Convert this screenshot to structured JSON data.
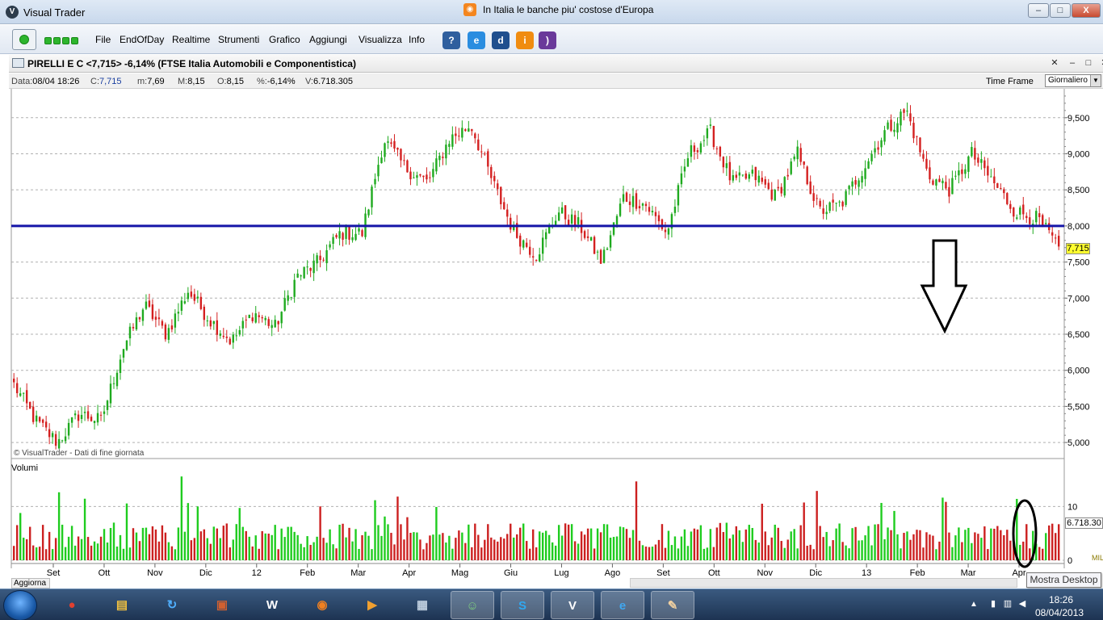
{
  "window": {
    "app_title": "Visual Trader",
    "news_headline": "In Italia le banche piu' costose d'Europa",
    "min_label": "–",
    "max_label": "□",
    "close_label": "X"
  },
  "menu": {
    "items": [
      "File",
      "EndOfDay",
      "Realtime",
      "Strumenti",
      "Grafico",
      "Aggiungi",
      "Visualizza",
      "Info"
    ]
  },
  "chart_window": {
    "title": "PIRELLI E C <7,715> -6,14%  (FTSE Italia Automobili e Componentistica)",
    "info": {
      "data_label": "Data:",
      "data_value": "08/04 18:26",
      "c_label": "C:",
      "c_value": "7,715",
      "m_label": "m:",
      "m_value": "7,69",
      "M_label": "M:",
      "M_value": "8,15",
      "o_label": "O:",
      "o_value": "8,15",
      "pct_label": "%:",
      "pct_value": "-6,14%",
      "v_label": "V:",
      "v_value": "6.718.305"
    },
    "time_frame_label": "Time Frame",
    "time_frame_value": "Giornaliero",
    "copyright": "© VisualTrader - Dati di fine giornata",
    "volume_label": "Volumi",
    "price_tag": "7,715",
    "volume_tag": "6.718.30",
    "volume_unit": "MIL",
    "refresh_button": "Aggiorna",
    "tooltip": "Mostra Desktop"
  },
  "chart_data": [
    {
      "type": "candlestick",
      "title": "",
      "series": [
        {
          "values": [
            5.8,
            5.3,
            5.0,
            5.4,
            5.3,
            6.3,
            6.9,
            6.5,
            7.1,
            6.7,
            6.4,
            6.8,
            6.6,
            7.3,
            7.5,
            7.9,
            7.9,
            9.2,
            8.8,
            8.6,
            9.2,
            9.4,
            8.6,
            7.9,
            7.6,
            8.2,
            8.0,
            7.5,
            8.4,
            8.3,
            7.9,
            9.0,
            9.3,
            8.6,
            8.7,
            8.4,
            9.0,
            8.2,
            8.3,
            8.8,
            9.3,
            9.6,
            8.7,
            8.5,
            9.0,
            8.6,
            8.2,
            8.1,
            7.7
          ]
        }
      ],
      "ylim": [
        4.8,
        9.9
      ],
      "y_ticks": [
        "5,000",
        "5,500",
        "6,000",
        "6,500",
        "7,000",
        "7,500",
        "8,000",
        "8,500",
        "9,000",
        "9,500"
      ],
      "x_labels": [
        "Set",
        "Ott",
        "Nov",
        "Dic",
        "12",
        "Feb",
        "Mar",
        "Apr",
        "Mag",
        "Giu",
        "Lug",
        "Ago",
        "Set",
        "Ott",
        "Nov",
        "Dic",
        "13",
        "Feb",
        "Mar",
        "Apr"
      ],
      "annotations": {
        "horizontal_line": 8.0,
        "last_price": 7.715,
        "arrow": "down"
      },
      "grid": true
    },
    {
      "type": "bar",
      "title": "Volumi",
      "y_ticks": [
        "0",
        "10"
      ],
      "ylim": [
        0,
        18
      ],
      "last_value": "6.718.30",
      "unit": "MIL"
    }
  ],
  "taskbar": {
    "time": "18:26",
    "date": "08/04/2013",
    "apps": [
      "explorer",
      "chrome",
      "files",
      "refresh",
      "archive",
      "word",
      "firefox",
      "media",
      "scanner",
      "messenger",
      "skype",
      "visualtrader",
      "ie",
      "paint"
    ]
  }
}
